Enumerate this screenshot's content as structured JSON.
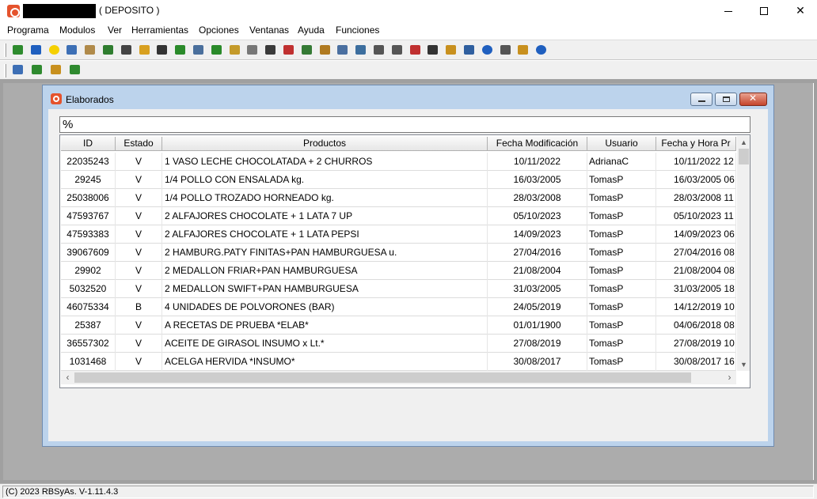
{
  "window": {
    "title": "( DEPOSITO )"
  },
  "menu": [
    "Programa",
    "Modulos",
    "Ver",
    "Herramientas",
    "Opciones",
    "Ventanas",
    "Ayuda",
    "Funciones"
  ],
  "toolbar1_icons": [
    {
      "name": "modules-icon",
      "color": "#2e8b2e"
    },
    {
      "name": "runner-icon",
      "color": "#1f5fbf"
    },
    {
      "name": "smiley-icon",
      "color": "#f5d000"
    },
    {
      "name": "form-icon",
      "color": "#3d6fb5"
    },
    {
      "name": "cabinet-icon",
      "color": "#b08a4a"
    },
    {
      "name": "money-bag-icon",
      "color": "#2f7d2f"
    },
    {
      "name": "bank-icon",
      "color": "#444444"
    },
    {
      "name": "documents-icon",
      "color": "#d8a020"
    },
    {
      "name": "grid-icon",
      "color": "#333333"
    },
    {
      "name": "arrow-left-icon",
      "color": "#2a8a2a"
    },
    {
      "name": "device-icon",
      "color": "#4a6f9c"
    },
    {
      "name": "arrow-right-icon",
      "color": "#2a8a2a"
    },
    {
      "name": "basket-icon",
      "color": "#c49a2a"
    },
    {
      "name": "clipboard-icon",
      "color": "#777777"
    },
    {
      "name": "shop-icon",
      "color": "#3a3a3a"
    },
    {
      "name": "calculator-icon",
      "color": "#c03030"
    },
    {
      "name": "register-icon",
      "color": "#357a35"
    },
    {
      "name": "list-icon",
      "color": "#b07a20"
    },
    {
      "name": "gear-document-icon",
      "color": "#4a6fa0"
    },
    {
      "name": "report-icon",
      "color": "#3c6e9e"
    },
    {
      "name": "truck-icon",
      "color": "#555555"
    },
    {
      "name": "dotted-grid-icon",
      "color": "#555555"
    },
    {
      "name": "network-icon",
      "color": "#c03030"
    },
    {
      "name": "table-icon",
      "color": "#333333"
    },
    {
      "name": "package-icon",
      "color": "#c8901e"
    },
    {
      "name": "windows-icon",
      "color": "#2f5f9f"
    },
    {
      "name": "info-icon",
      "color": "#1f5fbf"
    },
    {
      "name": "notepad-icon",
      "color": "#555555"
    },
    {
      "name": "transfer-icon",
      "color": "#c8901e"
    },
    {
      "name": "help-icon",
      "color": "#1f5fbf"
    }
  ],
  "toolbar2_icons": [
    {
      "name": "calendar-icon",
      "color": "#3d6fb5"
    },
    {
      "name": "chip-icon",
      "color": "#2f8a2f"
    },
    {
      "name": "lines-icon",
      "color": "#c8901e"
    },
    {
      "name": "exit-door-icon",
      "color": "#2f8a2f"
    }
  ],
  "child_window": {
    "title": "Elaborados",
    "search_value": "%",
    "columns": [
      "ID",
      "Estado",
      "Productos",
      "Fecha Modificación",
      "Usuario",
      "Fecha y Hora Pr"
    ],
    "rows": [
      [
        "22035243",
        "V",
        "1 VASO LECHE CHOCOLATADA + 2 CHURROS",
        "10/11/2022",
        "AdrianaC",
        "10/11/2022 12"
      ],
      [
        "29245",
        "V",
        "1/4 POLLO CON ENSALADA kg.",
        "16/03/2005",
        "TomasP",
        "16/03/2005 06"
      ],
      [
        "25038006",
        "V",
        "1/4 POLLO TROZADO HORNEADO kg.",
        "28/03/2008",
        "TomasP",
        "28/03/2008 11"
      ],
      [
        "47593767",
        "V",
        "2 ALFAJORES CHOCOLATE + 1 LATA 7 UP",
        "05/10/2023",
        "TomasP",
        "05/10/2023 11"
      ],
      [
        "47593383",
        "V",
        "2 ALFAJORES CHOCOLATE + 1 LATA PEPSI",
        "14/09/2023",
        "TomasP",
        "14/09/2023 06"
      ],
      [
        "39067609",
        "V",
        "2 HAMBURG.PATY FINITAS+PAN HAMBURGUESA u.",
        "27/04/2016",
        "TomasP",
        "27/04/2016 08"
      ],
      [
        "29902",
        "V",
        "2 MEDALLON FRIAR+PAN HAMBURGUESA",
        "21/08/2004",
        "TomasP",
        "21/08/2004 08"
      ],
      [
        "5032520",
        "V",
        "2 MEDALLON SWIFT+PAN HAMBURGUESA",
        "31/03/2005",
        "TomasP",
        "31/03/2005 18"
      ],
      [
        "46075334",
        "B",
        "4 UNIDADES DE POLVORONES (BAR)",
        "24/05/2019",
        "TomasP",
        "14/12/2019 10"
      ],
      [
        "25387",
        "V",
        "A RECETAS DE PRUEBA *ELAB*",
        "01/01/1900",
        "TomasP",
        "04/06/2018 08"
      ],
      [
        "36557302",
        "V",
        "ACEITE DE GIRASOL INSUMO x Lt.*",
        "27/08/2019",
        "TomasP",
        "27/08/2019 10"
      ],
      [
        "1031468",
        "V",
        "ACELGA HERVIDA *INSUMO*",
        "30/08/2017",
        "TomasP",
        "30/08/2017 16"
      ]
    ]
  },
  "status": {
    "text": "(C) 2023 RBSyAs. V-1.11.4.3"
  }
}
